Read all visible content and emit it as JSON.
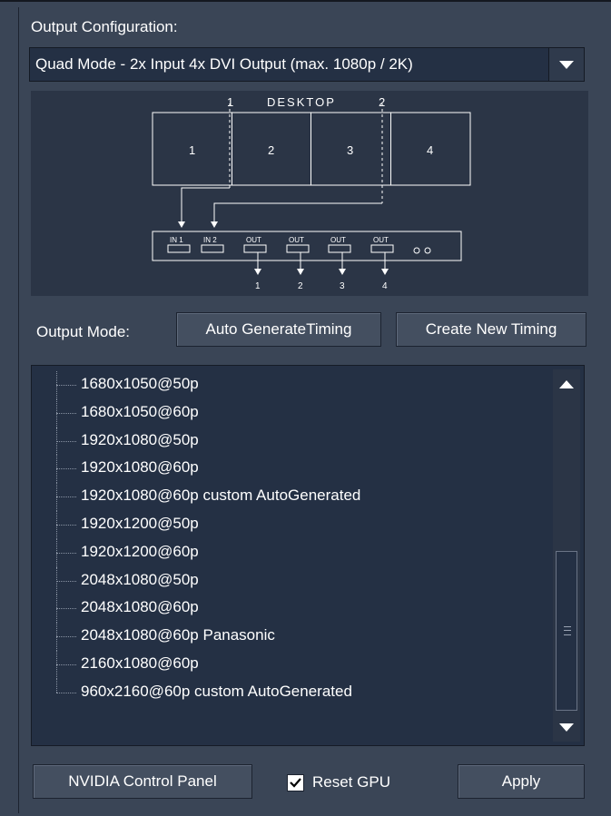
{
  "output_config": {
    "label": "Output Configuration:",
    "selected": "Quad Mode - 2x Input 4x DVI Output (max. 1080p / 2K)"
  },
  "diagram": {
    "desktop_label": "DESKTOP",
    "marker_1": "1",
    "marker_2": "2",
    "screens": [
      "1",
      "2",
      "3",
      "4"
    ],
    "inputs": [
      "IN 1",
      "IN 2"
    ],
    "outputs": [
      "OUT",
      "OUT",
      "OUT",
      "OUT"
    ],
    "output_numbers": [
      "1",
      "2",
      "3",
      "4"
    ]
  },
  "output_mode": {
    "label": "Output Mode:",
    "auto_button": "Auto GenerateTiming",
    "create_button": "Create New Timing"
  },
  "timings": [
    "1680x1050@50p",
    "1680x1050@60p",
    "1920x1080@50p",
    "1920x1080@60p",
    "1920x1080@60p custom AutoGenerated",
    "1920x1200@50p",
    "1920x1200@60p",
    "2048x1080@50p",
    "2048x1080@60p",
    "2048x1080@60p Panasonic",
    "2160x1080@60p",
    "960x2160@60p custom AutoGenerated"
  ],
  "footer": {
    "nvidia_button": "NVIDIA Control Panel",
    "reset_gpu_label": "Reset GPU",
    "reset_gpu_checked": true,
    "apply_button": "Apply"
  },
  "colors": {
    "panel": "#3a4556",
    "field": "#243044",
    "button": "#444f60"
  }
}
